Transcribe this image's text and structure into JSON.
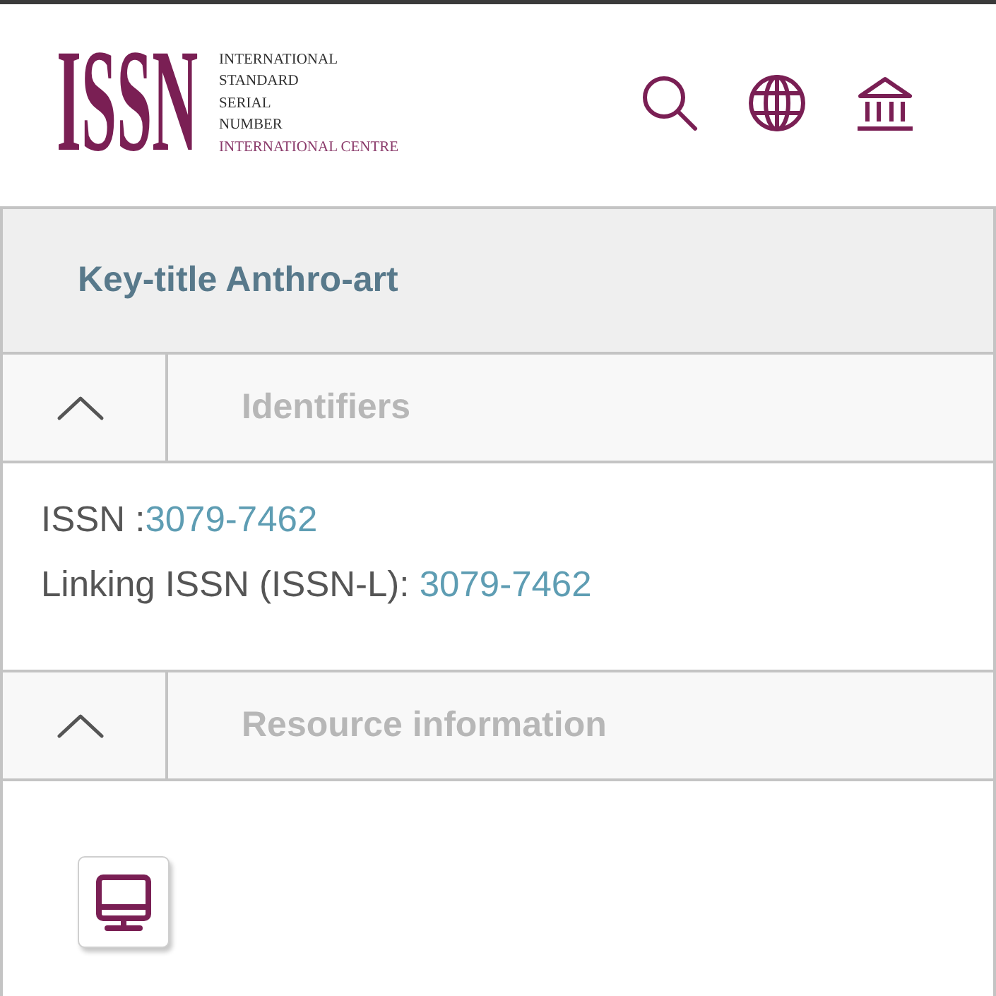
{
  "header": {
    "logo": {
      "mark": "ISSN",
      "lines": [
        "INTERNATIONAL",
        "STANDARD",
        "SERIAL",
        "NUMBER"
      ],
      "subtitle": "INTERNATIONAL CENTRE"
    }
  },
  "record": {
    "key_title": "Key-title Anthro-art",
    "sections": [
      {
        "kind": "identifiers",
        "title": "Identifiers",
        "expanded": true,
        "fields": [
          {
            "label": "ISSN :",
            "value": "3079-7462"
          },
          {
            "label": "Linking ISSN (ISSN-L): ",
            "value": "3079-7462"
          }
        ]
      },
      {
        "kind": "resource",
        "title": "Resource information",
        "expanded": true
      }
    ]
  }
}
